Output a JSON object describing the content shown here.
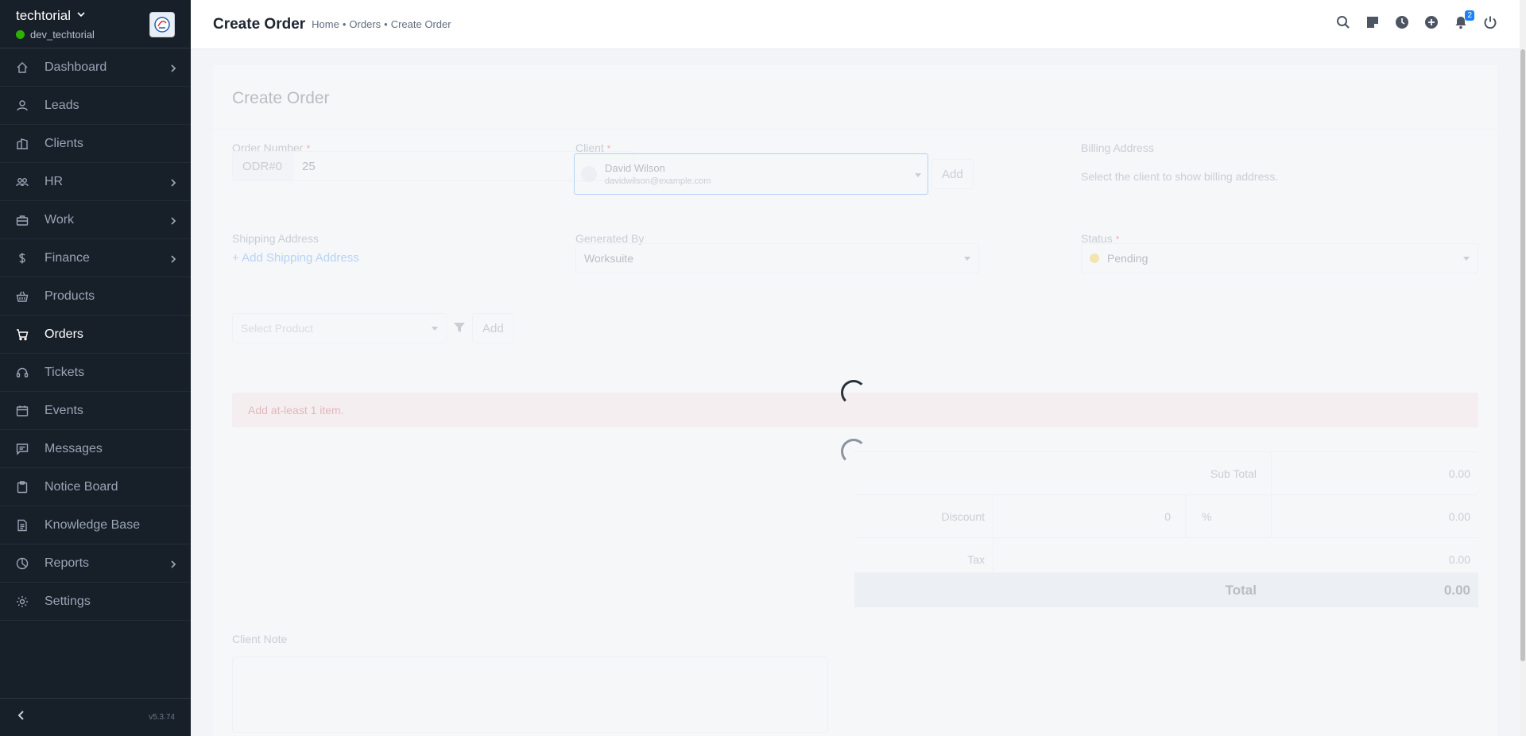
{
  "sidebar": {
    "company": "techtorial",
    "user": "dev_techtorial",
    "version": "v5.3.74",
    "items": [
      {
        "label": "Dashboard",
        "icon": "house-icon"
      },
      {
        "label": "Leads",
        "icon": "person-icon"
      },
      {
        "label": "Clients",
        "icon": "building-icon"
      },
      {
        "label": "HR",
        "icon": "people-icon"
      },
      {
        "label": "Work",
        "icon": "briefcase-icon"
      },
      {
        "label": "Finance",
        "icon": "dollar-icon"
      },
      {
        "label": "Products",
        "icon": "basket-icon"
      },
      {
        "label": "Orders",
        "icon": "cart-icon"
      },
      {
        "label": "Tickets",
        "icon": "headset-icon"
      },
      {
        "label": "Events",
        "icon": "calendar-icon"
      },
      {
        "label": "Messages",
        "icon": "chat-icon"
      },
      {
        "label": "Notice Board",
        "icon": "clipboard-icon"
      },
      {
        "label": "Knowledge Base",
        "icon": "document-icon"
      },
      {
        "label": "Reports",
        "icon": "pie-chart-icon"
      },
      {
        "label": "Settings",
        "icon": "gear-icon"
      }
    ],
    "active": "Orders"
  },
  "header": {
    "title": "Create Order",
    "breadcrumb": [
      "Home",
      "Orders",
      "Create Order"
    ],
    "notification_count": "2"
  },
  "form": {
    "card_title": "Create Order",
    "order_number_label": "Order Number",
    "order_prefix": "ODR#0",
    "order_number": "25",
    "client_label": "Client",
    "client_name": "David Wilson",
    "client_email": "davidwilson@example.com",
    "add_label": "Add",
    "billing_label": "Billing Address",
    "billing_placeholder": "Select the client to show billing address.",
    "shipping_label": "Shipping Address",
    "add_shipping": "Add Shipping Address",
    "generated_by_label": "Generated By",
    "generated_by": "Worksuite",
    "status_label": "Status",
    "status": "Pending",
    "select_product_placeholder": "Select Product",
    "alert": "Add at-least 1 item.",
    "sub_total_label": "Sub Total",
    "sub_total": "0.00",
    "discount_label": "Discount",
    "discount_value": "0",
    "discount_type": "%",
    "discount_amount": "0.00",
    "tax_label": "Tax",
    "tax": "0.00",
    "total_label": "Total",
    "total": "0.00",
    "client_note_label": "Client Note"
  },
  "colors": {
    "sidebar_bg": "#171f29",
    "accent": "#1d82f5",
    "online": "#2cb100",
    "status_pending": "#fcbd01"
  }
}
